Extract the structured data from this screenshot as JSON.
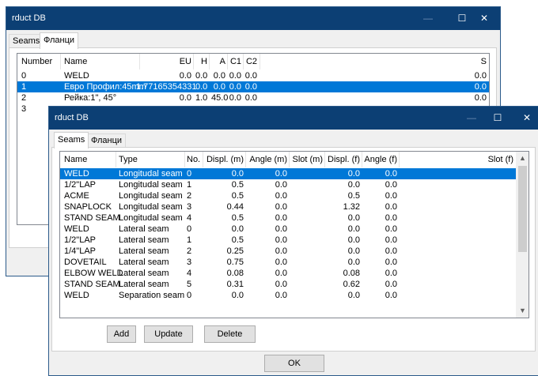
{
  "back_window": {
    "title": "rduct DB",
    "tabs": [
      "Seams",
      "Фланци"
    ],
    "columns": [
      "Number",
      "Name",
      "EU",
      "H",
      "A",
      "C1",
      "C2",
      "S"
    ],
    "rows": [
      [
        "0",
        "WELD",
        "0.0",
        "0.0",
        "0.0",
        "0.0",
        "0.0",
        "0.0"
      ],
      [
        "1",
        "Евро Профил:45mm",
        "1.77165354331",
        "0.0",
        "0.0",
        "0.0",
        "0.0",
        "0.0"
      ],
      [
        "2",
        "Рейка:1\", 45°",
        "0.0",
        "1.0",
        "45.0",
        "0.0",
        "0.0",
        "0.0"
      ],
      [
        "3",
        "",
        "",
        "",
        "",
        "",
        "",
        ""
      ]
    ],
    "selected_row": 1
  },
  "front_window": {
    "title": "rduct DB",
    "tabs": [
      "Seams",
      "Фланци"
    ],
    "columns": [
      "Name",
      "Type",
      "No.",
      "Displ. (m)",
      "Angle (m)",
      "Slot (m)",
      "Displ. (f)",
      "Angle (f)",
      "Slot (f)"
    ],
    "rows": [
      [
        "WELD",
        "Longitudal seam",
        "0",
        "0.0",
        "0.0",
        "",
        "0.0",
        "0.0"
      ],
      [
        "1/2\"LAP",
        "Longitudal seam",
        "1",
        "0.5",
        "0.0",
        "",
        "0.0",
        "0.0"
      ],
      [
        "ACME",
        "Longitudal seam",
        "2",
        "0.5",
        "0.0",
        "",
        "0.5",
        "0.0"
      ],
      [
        "SNAPLOCK",
        "Longitudal seam",
        "3",
        "0.44",
        "0.0",
        "",
        "1.32",
        "0.0"
      ],
      [
        "STAND SEAM",
        "Longitudal seam",
        "4",
        "0.5",
        "0.0",
        "",
        "0.0",
        "0.0"
      ],
      [
        "WELD",
        "Lateral seam",
        "0",
        "0.0",
        "0.0",
        "",
        "0.0",
        "0.0"
      ],
      [
        "1/2\"LAP",
        "Lateral seam",
        "1",
        "0.5",
        "0.0",
        "",
        "0.0",
        "0.0"
      ],
      [
        "1/4\"LAP",
        "Lateral seam",
        "2",
        "0.25",
        "0.0",
        "",
        "0.0",
        "0.0"
      ],
      [
        "DOVETAIL",
        "Lateral seam",
        "3",
        "0.75",
        "0.0",
        "",
        "0.0",
        "0.0"
      ],
      [
        "ELBOW WELD",
        "Lateral seam",
        "4",
        "0.08",
        "0.0",
        "",
        "0.08",
        "0.0"
      ],
      [
        "STAND SEAM",
        "Lateral seam",
        "5",
        "0.31",
        "0.0",
        "",
        "0.62",
        "0.0"
      ],
      [
        "WELD",
        "Separation seam",
        "0",
        "0.0",
        "0.0",
        "",
        "0.0",
        "0.0"
      ]
    ],
    "selected_row": 0,
    "buttons": {
      "add": "Add",
      "update": "Update",
      "delete": "Delete",
      "ok": "OK"
    }
  },
  "icons": {
    "minimize": "minimize-icon",
    "maximize": "maximize-icon",
    "close": "close-icon",
    "scroll_up": "chevron-up-icon",
    "scroll_down": "chevron-down-icon"
  },
  "colors": {
    "titlebar": "#0c3f74",
    "selection": "#0078d7",
    "window_bg": "#f0f0f0"
  }
}
